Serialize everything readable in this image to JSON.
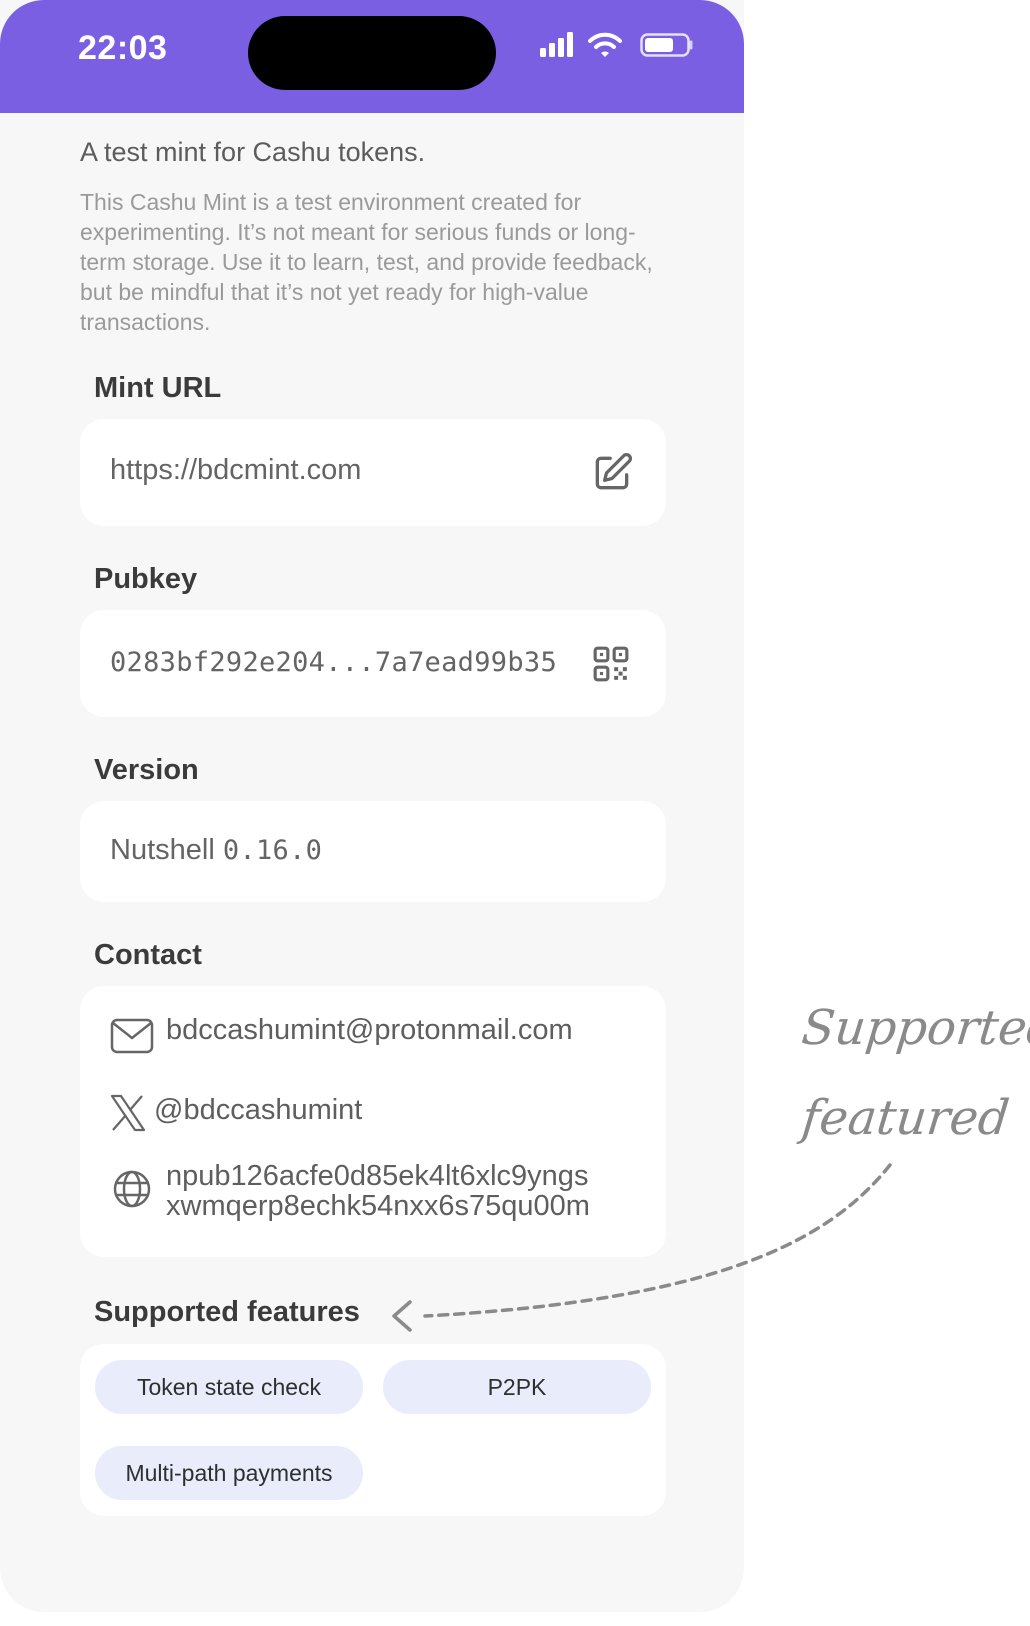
{
  "status_bar": {
    "time": "22:03"
  },
  "intro": {
    "title": "A test mint for Cashu tokens.",
    "body": "This Cashu Mint is a test environment created for experimenting. It’s not meant for serious funds or long-term storage. Use it to learn, test, and provide feedback, but be mindful that it’s not yet ready for high-value transactions."
  },
  "mint_url": {
    "label": "Mint URL",
    "value": "https://bdcmint.com",
    "action_icon": "edit-icon"
  },
  "pubkey": {
    "label": "Pubkey",
    "value": "0283bf292e204...7a7ead99b35",
    "action_icon": "qr-code-icon"
  },
  "version": {
    "label": "Version",
    "value_name": "Nutshell",
    "value_number": "0.16.0"
  },
  "contact": {
    "label": "Contact",
    "email": "bdccashumint@protonmail.com",
    "x_handle": "@bdccashumint",
    "nostr_line1": "npub126acfe0d85ek4lt6xlc9yngs",
    "nostr_line2": "xwmqerp8echk54nxx6s75qu00m"
  },
  "features": {
    "label": "Supported features",
    "chips": [
      "Token state check",
      "P2PK",
      "Multi-path payments"
    ]
  },
  "annotation": {
    "line1": "Supported",
    "line2": "featured"
  },
  "colors": {
    "accent": "#7b5fe3",
    "chip_bg": "#e8ecfb",
    "background": "#f7f7f7"
  }
}
